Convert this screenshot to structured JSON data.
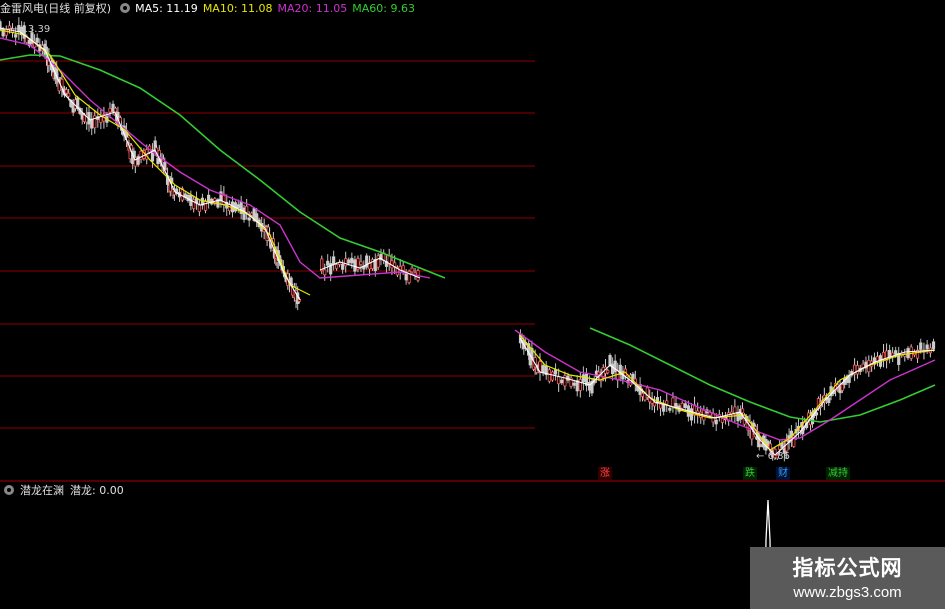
{
  "header": {
    "stock_name": "金雷风电(日线 前复权)",
    "ma5": "MA5: 11.19",
    "ma10": "MA10: 11.08",
    "ma20": "MA20: 11.05",
    "ma60": "MA60: 9.63"
  },
  "price_labels": {
    "high": "13.39",
    "low": "6.86"
  },
  "signals": {
    "zhang": "涨",
    "die": "跌",
    "cai": "财",
    "jianchi": "减持"
  },
  "sub_panel": {
    "title": "潜龙在渊",
    "series_label": "潜龙: 0.00"
  },
  "watermark": {
    "title": "指标公式网",
    "url": "www.zbgs3.com"
  },
  "colors": {
    "ma5": "#ffffff",
    "ma10": "#e6e600",
    "ma20": "#cc33cc",
    "ma60": "#33cc33",
    "grid": "#8b0000",
    "candle": "#cccccc",
    "background": "#000000"
  }
}
